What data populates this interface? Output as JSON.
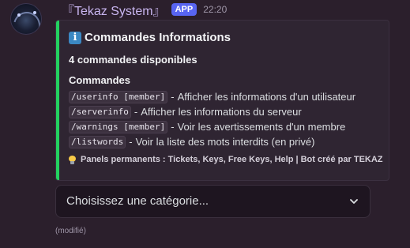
{
  "message": {
    "username": "『Tekaz System』",
    "app_badge": "APP",
    "timestamp": "22:20",
    "edited_label": "(modifié)"
  },
  "embed": {
    "accent_color": "#23d160",
    "title_icon": "info-icon",
    "title_icon_glyph": "i",
    "title": "Commandes Informations",
    "subtitle": "4 commandes disponibles",
    "field_name": "Commandes",
    "commands": [
      {
        "code": "/userinfo [member]",
        "separator": "-",
        "description": "Afficher les informations d'un utilisateur"
      },
      {
        "code": "/serverinfo",
        "separator": "-",
        "description": "Afficher les informations du serveur"
      },
      {
        "code": "/warnings [member]",
        "separator": "-",
        "description": "Voir les avertissements d'un membre"
      },
      {
        "code": "/listwords",
        "separator": "-",
        "description": "Voir la liste des mots interdits (en privé)"
      }
    ],
    "footer_icon": "lightbulb-icon",
    "footer_text": "Panels permanents : Tickets, Keys, Free Keys, Help | Bot créé par TEKAZ"
  },
  "select_menu": {
    "placeholder": "Choisissez une catégorie...",
    "icon": "chevron-down-icon"
  },
  "colors": {
    "background": "#2b1f2c",
    "username": "#c9b6f0",
    "app_badge": "#5865f2",
    "embed_background": "#2f2532"
  }
}
